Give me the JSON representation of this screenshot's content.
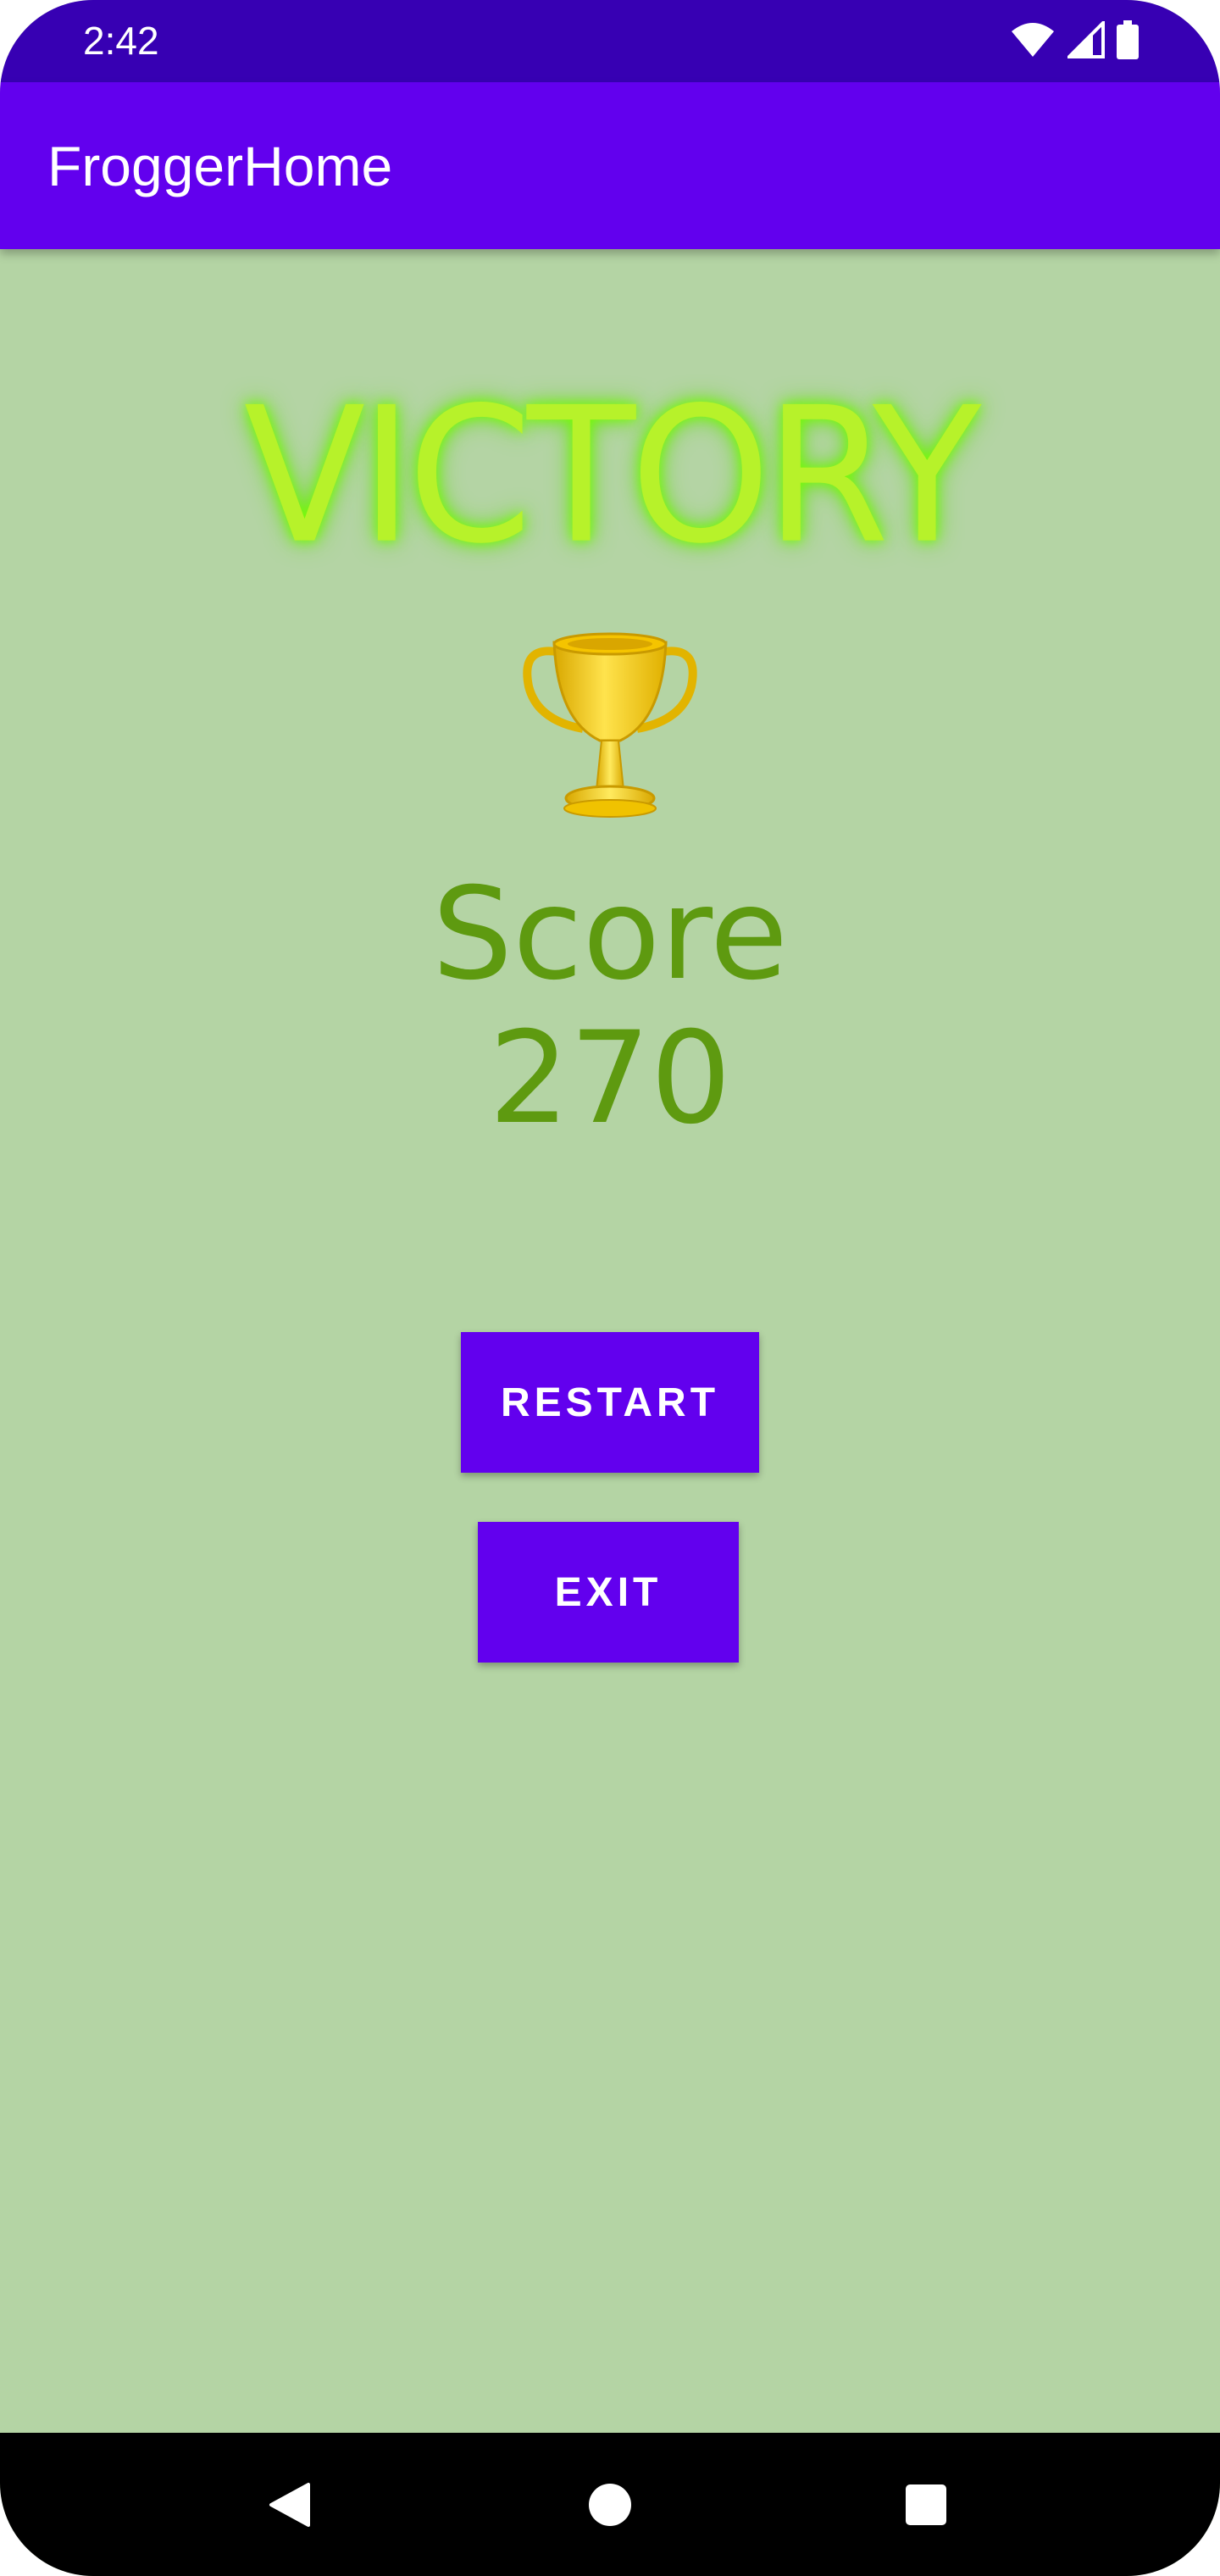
{
  "status_bar": {
    "time": "2:42",
    "icons": [
      "wifi-icon",
      "signal-icon",
      "battery-icon"
    ],
    "background": "#3700b3"
  },
  "app_bar": {
    "title": "FroggerHome",
    "background": "#6200ee"
  },
  "main": {
    "headline": "VICTORY",
    "trophy_icon": "trophy-icon",
    "score_label": "Score",
    "score_value": "270",
    "background": "#b4d4a4",
    "headline_color": "#b7f22a",
    "score_color": "#5e9a10"
  },
  "buttons": {
    "restart_label": "RESTART",
    "exit_label": "EXIT",
    "color": "#6200ee"
  },
  "nav_bar": {
    "icons": [
      "back-icon",
      "home-icon",
      "recents-icon"
    ],
    "background": "#000000"
  }
}
